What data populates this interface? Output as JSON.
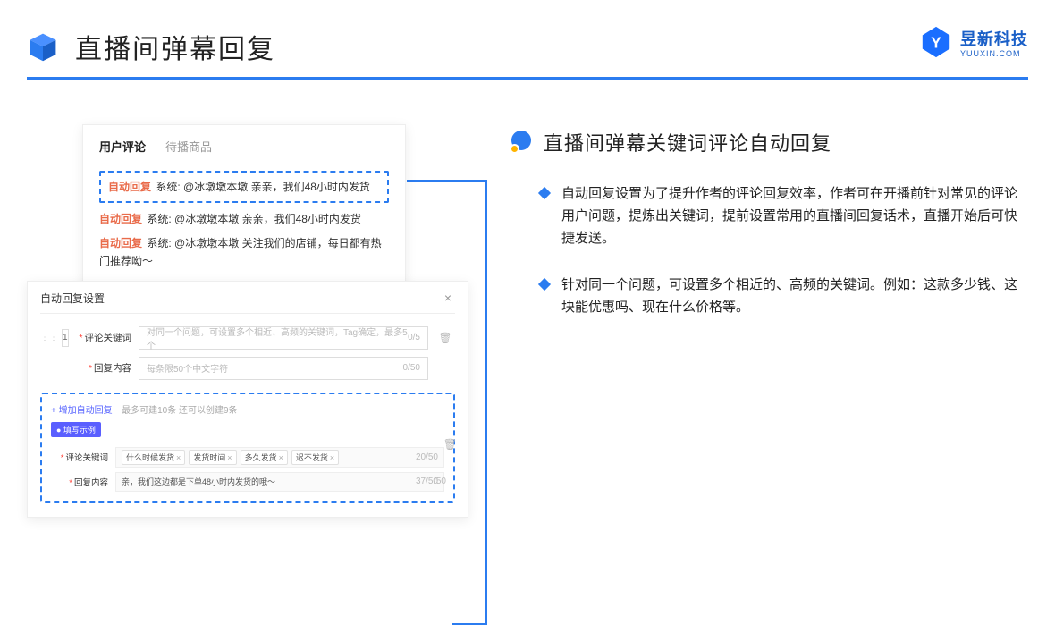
{
  "header": {
    "title": "直播间弹幕回复"
  },
  "brand": {
    "name": "昱新科技",
    "sub": "YUUXIN.COM"
  },
  "comments": {
    "tabs": {
      "active": "用户评论",
      "inactive": "待播商品"
    },
    "items": [
      {
        "tag": "自动回复",
        "sys": "系统:",
        "text": "@冰墩墩本墩 亲亲，我们48小时内发货"
      },
      {
        "tag": "自动回复",
        "sys": "系统:",
        "text": "@冰墩墩本墩 亲亲，我们48小时内发货"
      },
      {
        "tag": "自动回复",
        "sys": "系统:",
        "text": "@冰墩墩本墩 关注我们的店铺，每日都有热门推荐呦～"
      }
    ]
  },
  "settings": {
    "title": "自动回复设置",
    "index": "1",
    "label_keyword": "评论关键词",
    "keyword_placeholder": "对同一个问题，可设置多个相近、高频的关键词，Tag确定，最多5个",
    "keyword_counter": "0/5",
    "label_content": "回复内容",
    "content_placeholder": "每条限50个中文字符",
    "content_counter": "0/50",
    "add_label": "+ 增加自动回复",
    "add_hint": "最多可建10条 还可以创建9条",
    "example_badge": "● 填写示例",
    "example_keyword_label": "评论关键词",
    "example_tags": [
      "什么时候发货",
      "发货时间",
      "多久发货",
      "迟不发货"
    ],
    "example_keyword_counter": "20/50",
    "example_content_label": "回复内容",
    "example_content_value": "亲，我们这边都是下单48小时内发货的哦～",
    "example_content_counter": "37/50",
    "outer_counter": "/50"
  },
  "right": {
    "section_title": "直播间弹幕关键词评论自动回复",
    "bullets": [
      "自动回复设置为了提升作者的评论回复效率，作者可在开播前针对常见的评论用户问题，提炼出关键词，提前设置常用的直播间回复话术，直播开始后可快捷发送。",
      "针对同一个问题，可设置多个相近的、高频的关键词。例如：这款多少钱、这块能优惠吗、现在什么价格等。"
    ]
  }
}
